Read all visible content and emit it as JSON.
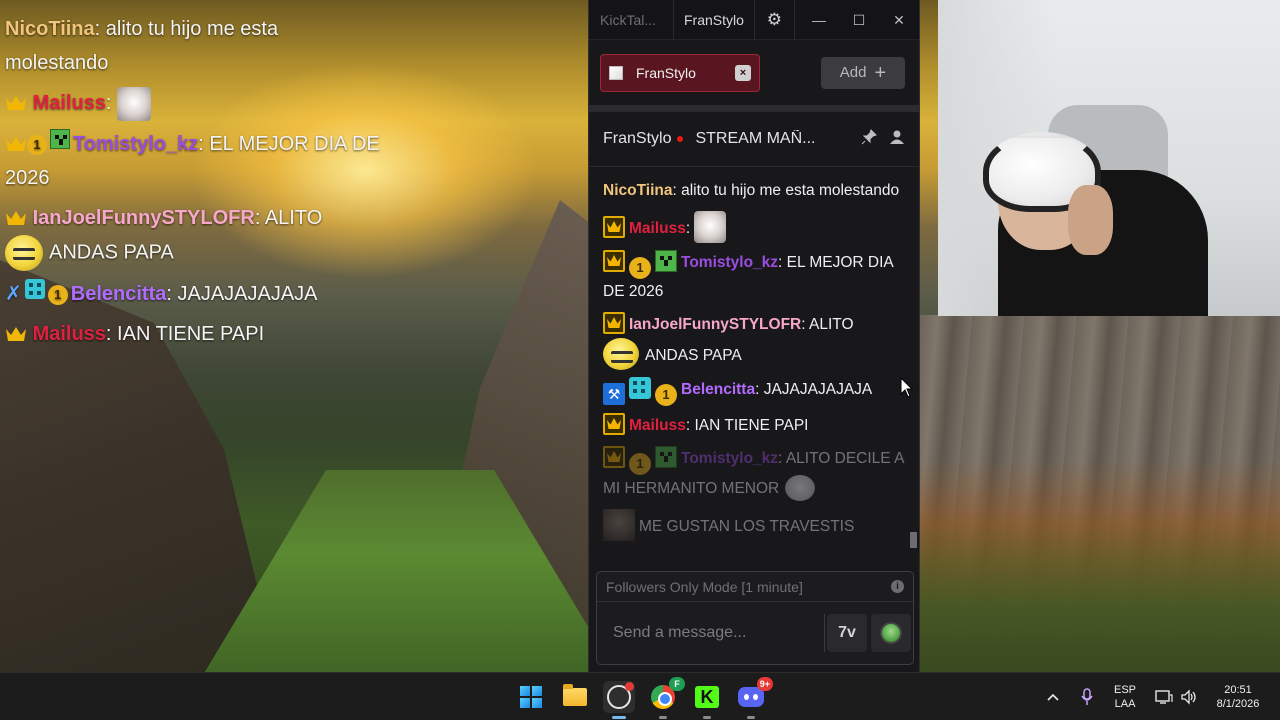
{
  "overlay_chat": [
    {
      "nick": "NicoTiina",
      "nick_color": "#f2c57c",
      "text": "alito tu hijo me esta molestando"
    },
    {
      "nick": "Mailuss",
      "nick_color": "#e02040",
      "text": ""
    },
    {
      "nick": "Tomistylo_kz",
      "nick_color": "#9b4de0",
      "text": "EL MEJOR DIA DE 2026"
    },
    {
      "nick": "IanJoelFunnySTYLOFR",
      "nick_color": "#f7a7c9",
      "text1": "ALITO",
      "text2": "ANDAS PAPA"
    },
    {
      "nick": "Belencitta",
      "nick_color": "#b26bff",
      "text": "JAJAJAJAJAJA"
    },
    {
      "nick": "Mailuss",
      "nick_color": "#e02040",
      "text": "IAN TIENE PAPI"
    }
  ],
  "app": {
    "name": "KickTal...",
    "title_tab": "FranStylo",
    "icons": {
      "settings": "gear-icon",
      "minimize": "minimize-icon",
      "maximize": "maximize-icon",
      "close": "close-icon"
    },
    "channel_chip": {
      "name": "FranStylo",
      "close_glyph": "×"
    },
    "add_button": {
      "label": "Add",
      "plus": "+"
    },
    "stream": {
      "channel": "FranStylo",
      "title": "STREAM MAÑ...",
      "status_color": "#e91916"
    },
    "chat": [
      {
        "nick": "NicoTiina",
        "nick_color": "#f2c57c",
        "text": "alito tu hijo me esta molestando"
      },
      {
        "nick": "Mailuss",
        "nick_color": "#e02040",
        "text": ""
      },
      {
        "nick": "Tomistylo_kz",
        "nick_color": "#9b4de0",
        "text": "EL MEJOR DIA DE 2026"
      },
      {
        "nick": "IanJoelFunnySTYLOFR",
        "nick_color": "#f7a7c9",
        "text1": "ALITO",
        "text2": "ANDAS PAPA"
      },
      {
        "nick": "Belencitta",
        "nick_color": "#b26bff",
        "text": "JAJAJAJAJAJA"
      },
      {
        "nick": "Mailuss",
        "nick_color": "#e02040",
        "text": "IAN TIENE PAPI"
      },
      {
        "nick": "Tomistylo_kz",
        "nick_color": "#9b4de0",
        "text": "ALITO DECILE A MI HERMANITO MENOR"
      },
      {
        "nick": "",
        "nick_color": "#ffffff",
        "text": "ME GUSTAN LOS TRAVESTIS"
      }
    ],
    "composer": {
      "mode": "Followers Only Mode [1 minute]",
      "placeholder": "Send a message...",
      "info_glyph": "i",
      "translate_glyph": "7v"
    }
  },
  "taskbar": {
    "apps": [
      "start",
      "file-explorer",
      "obs",
      "chrome",
      "kick",
      "discord"
    ],
    "chrome_badge": "F",
    "discord_badge": "9+",
    "kick_glyph": "K",
    "language": "ESP",
    "layout": "LAA",
    "time": "20:51",
    "date": "8/1/2026"
  }
}
